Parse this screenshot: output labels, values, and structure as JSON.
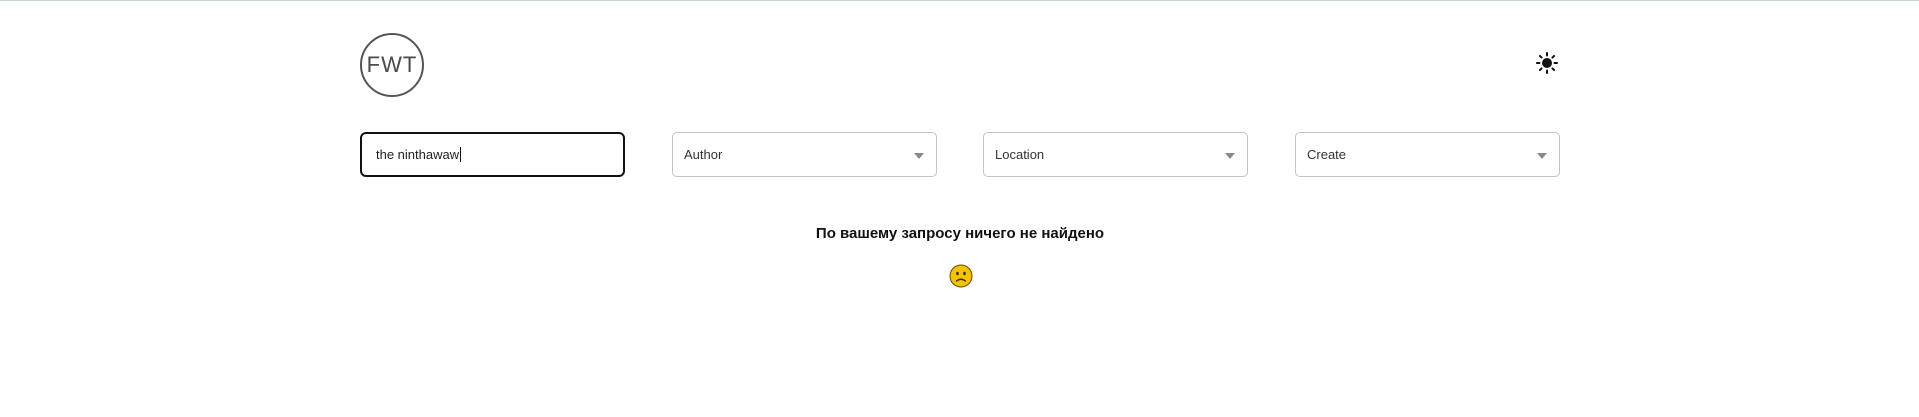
{
  "header": {
    "logo_text": "FWT",
    "theme_icon": "sun-icon"
  },
  "filters": {
    "search": {
      "value": "the ninthawaw"
    },
    "author": {
      "selected": "Author"
    },
    "location": {
      "selected": "Location"
    },
    "create": {
      "selected": "Create"
    }
  },
  "results": {
    "empty_message": "По вашему запросу ничего не найдено",
    "empty_icon": "sad-face-emoji-icon"
  },
  "colors": {
    "emoji_fill": "#f5c400",
    "border_active": "#111111",
    "border_default": "#c4c4c4"
  }
}
